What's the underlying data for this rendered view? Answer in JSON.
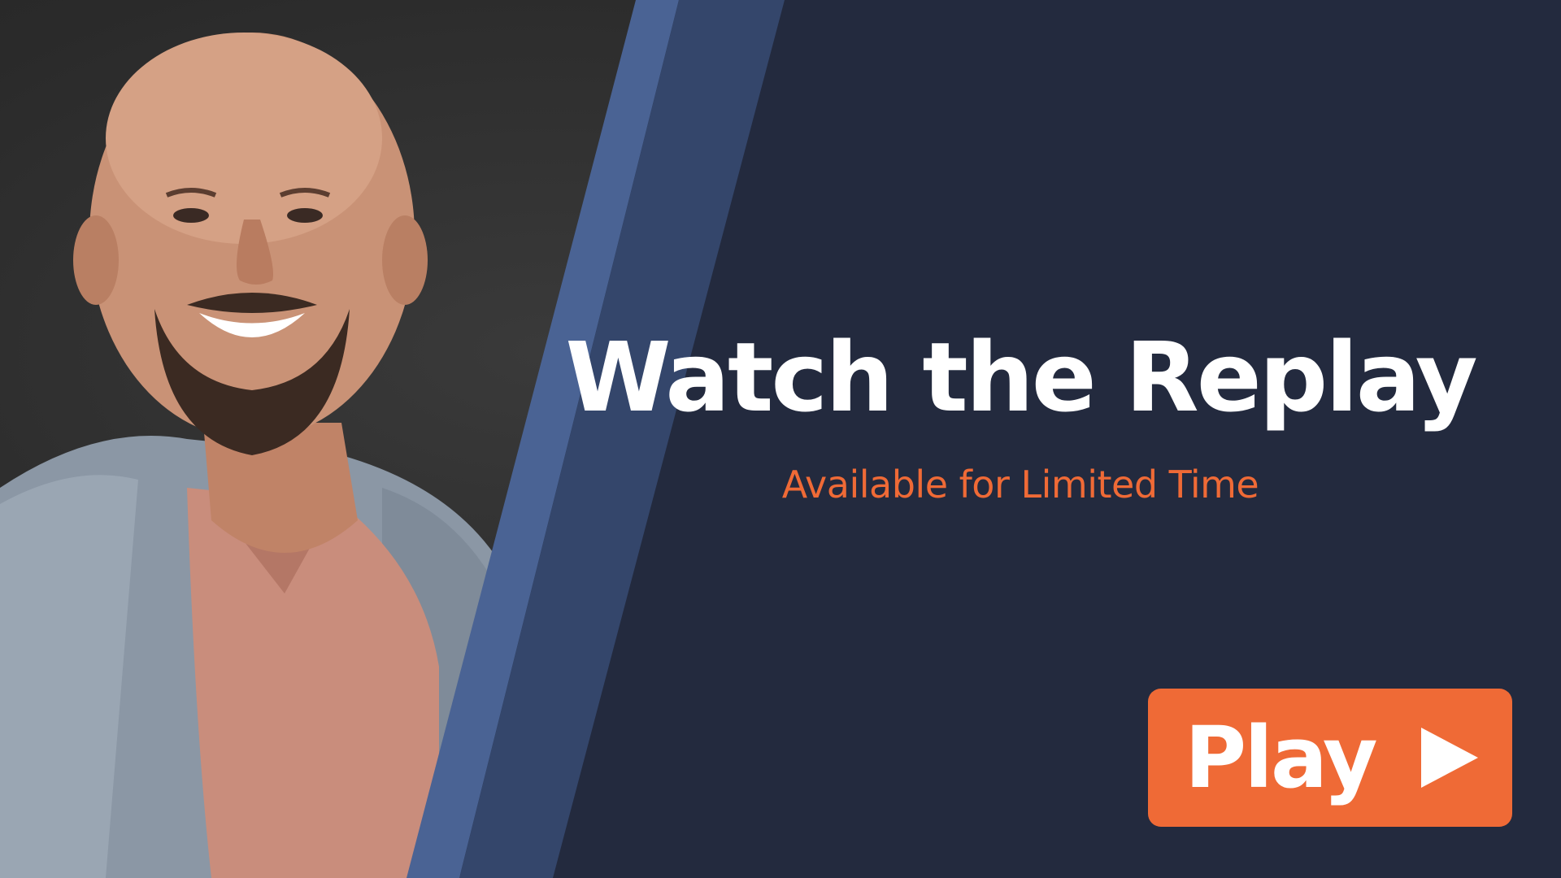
{
  "headline": "Watch the Replay",
  "subheadline": "Available for Limited Time",
  "play_button": {
    "label": "Play",
    "icon": "play-triangle-icon"
  },
  "colors": {
    "background": "#232a3e",
    "accent": "#ef6a36",
    "stripe_light": "#4a6394",
    "stripe_mid": "#34466b",
    "text": "#ffffff"
  },
  "photo": {
    "subject": "presenter-portrait"
  }
}
